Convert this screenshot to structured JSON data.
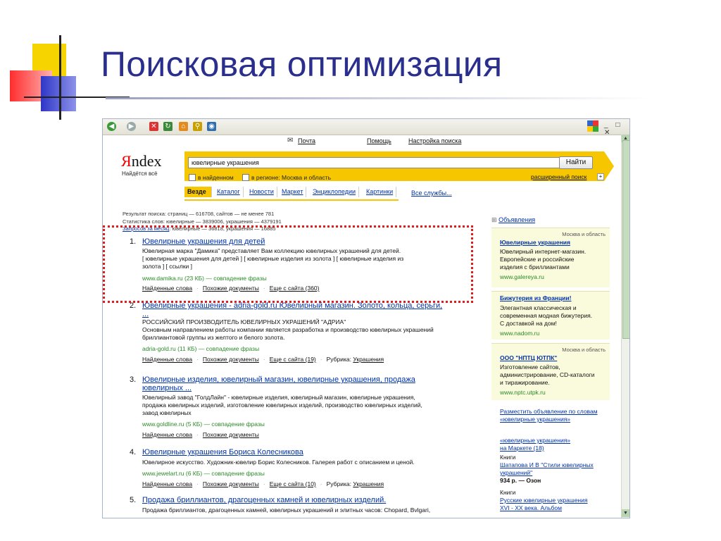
{
  "slide": {
    "title": "Поисковая оптимизация"
  },
  "browser": {
    "toolbar": {
      "back_glyph": "◀",
      "forward_glyph": "▶",
      "stop_glyph": "✕",
      "refresh_glyph": "↻",
      "home_glyph": "⌂",
      "search_glyph": "⚲",
      "web_glyph": "◉",
      "window_controls": "_ □ ✕"
    },
    "top_links": {
      "mail": "Почта",
      "help": "Помощь",
      "settings": "Настройка поиска"
    },
    "logo": {
      "brand_y": "Я",
      "brand_rest": "ndex",
      "slogan": "Найдётся всё"
    },
    "search": {
      "query": "ювелирные украшения",
      "button": "Найти",
      "in_found": "в найденном",
      "in_region": "в регионе: Москва и область",
      "advanced": "расширенный поиск",
      "plus": "+"
    },
    "tabs": [
      "Везде",
      "Каталог",
      "Новости",
      "Маркет",
      "Энциклопедии",
      "Картинки"
    ],
    "all_services": "Все службы...",
    "stats": {
      "line1": "Результат поиска: страниц — 616708, сайтов — не менее 781",
      "line2": "Статистика слов: ювелирные — 3839006, украшения — 4379191",
      "line3_link": "Запросов за месяц",
      "line3_rest": ": ювелирные — 36818, украшения — 16885"
    },
    "results": [
      {
        "num": "1.",
        "title": "Ювелирные украшения для детей",
        "snippet": [
          "Ювелирная марка \"Дамика\" представляет Вам коллекцию ювелирных украшений для детей.",
          "[ ювелирные украшения для детей ] [ ювелирные изделия из золота ] [ ювелирные изделия из",
          "золота ] [ ссылки ]"
        ],
        "url": "www.damika.ru (23 КБ) — совпадение фразы",
        "links": [
          "Найденные слова",
          "Похожие документы",
          "Еще с сайта (360)"
        ]
      },
      {
        "num": "2.",
        "title": "Ювелирные украшения - adria-gold.ru Ювелирный магазин. Золото, кольца, серьги,",
        "title2": "...",
        "snippet": [
          "РОССИЙСКИЙ ПРОИЗВОДИТЕЛЬ ЮВЕЛИРНЫХ УКРАШЕНИЙ \"АДРИА\"",
          "Основным направлением работы компании является разработка и производство ювелирных украшений",
          "бриллиантовой группы из желтого и белого золота."
        ],
        "url": "adria-gold.ru (11 КБ) — совпадение фразы",
        "links": [
          "Найденные слова",
          "Похожие документы",
          "Еще с сайта (19)"
        ],
        "rubric_label": "Рубрика:",
        "rubric": "Украшения"
      },
      {
        "num": "3.",
        "title": "Ювелирные изделия, ювелирный магазин, ювелирные украшения, продажа",
        "title2": "ювелирных ...",
        "snippet": [
          "Ювелирный завод \"ГолдЛайн\" - ювелирные изделия, ювелирный магазин, ювелирные украшения,",
          "продажа ювелирных изделий, изготовление ювелирных изделий, производство ювелирных изделий,",
          "завод ювелирных"
        ],
        "url": "www.goldline.ru (5 КБ) — совпадение фразы",
        "links": [
          "Найденные слова",
          "Похожие документы"
        ]
      },
      {
        "num": "4.",
        "title": "Ювелирные украшения Бориса Колесникова",
        "snippet": [
          "Ювелирное искусство. Художник-ювелир Борис Колесников. Галерея работ с описанием и ценой."
        ],
        "url": "www.jewelart.ru (6 КБ) — совпадение фразы",
        "links": [
          "Найденные слова",
          "Похожие документы",
          "Еще с сайта (10)"
        ],
        "rubric_label": "Рубрика:",
        "rubric": "Украшения"
      },
      {
        "num": "5.",
        "title": "Продажа бриллиантов, драгоценных камней и ювелирных изделий.",
        "snippet": [
          "Продажа бриллиантов, драгоценных камней, ювелирных украшений и элитных часов: Chopard, Bvlgari,"
        ]
      }
    ],
    "ads": {
      "header": "Объявления",
      "items": [
        {
          "region": "Москва и область",
          "title": "Ювелирные украшения",
          "text": [
            "Ювелирный интернет-магазин.",
            "Европейские и российские",
            "изделия с бриллиантами"
          ],
          "url": "www.galereya.ru"
        },
        {
          "region": "",
          "title": "Бижутерия из Франции!",
          "text": [
            "Элегантная классическая и",
            "современная модная бижутерия.",
            "С доставкой на дом!"
          ],
          "url": "www.nadom.ru"
        },
        {
          "region": "Москва и область",
          "title": "ООО \"НПТЦ ЮТПК\"",
          "text": [
            "Изготовление сайтов,",
            "администрирование, CD-каталоги",
            "и тиражирование."
          ],
          "url": "www.nptc.utpk.ru"
        }
      ],
      "place_ad": [
        "Разместить объявление по словам",
        "«ювелирные украшения»"
      ],
      "market": [
        "«ювелирные украшения»",
        "на Маркете (18)"
      ],
      "books_label": "Книги",
      "book1": [
        "Шатапова И В \"Стили ювелирных",
        "украшений\""
      ],
      "book1_price": "934 р. — Озон",
      "books_label2": "Книги",
      "book2": [
        "Русские ювелирные украшения",
        "XVI - XX века. Альбом"
      ]
    }
  }
}
